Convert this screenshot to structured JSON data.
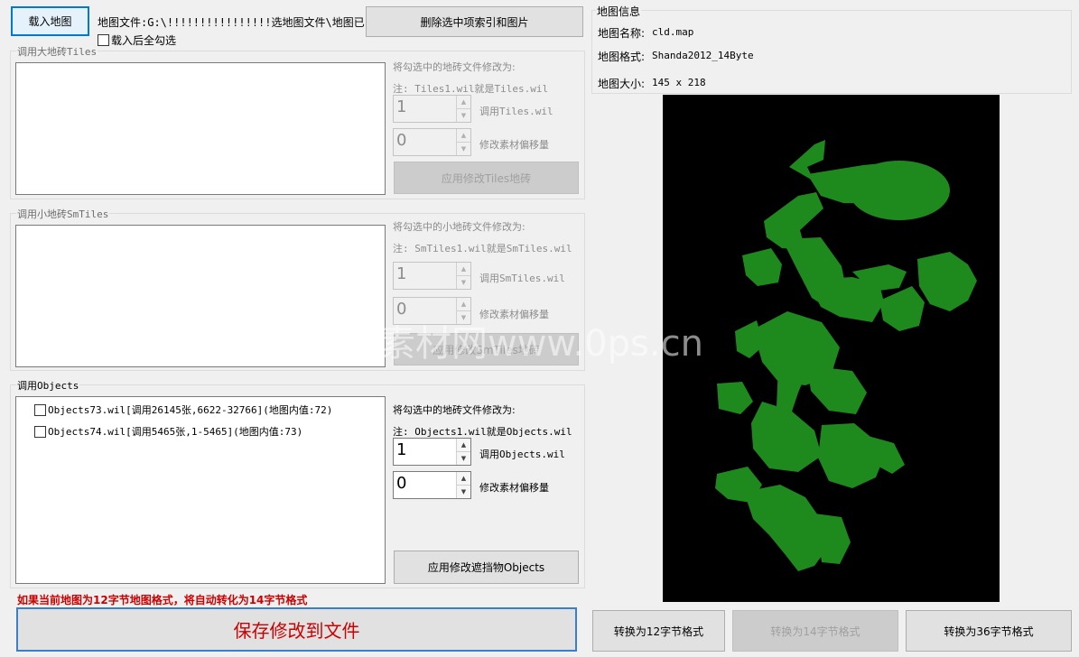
{
  "toolbar": {
    "load_map_label": "载入地图",
    "map_file_text": "地图文件:G:\\!!!!!!!!!!!!!!!!选地图文件\\地图已完成\\",
    "delete_selected_label": "删除选中项索引和图片",
    "select_all_after_load_label": "载入后全勾选",
    "select_all_after_load_checked": false
  },
  "tiles": {
    "legend": "调用大地砖Tiles",
    "change_to_label": "将勾选中的地砖文件修改为:",
    "note": "注: Tiles1.wil就是Tiles.wil",
    "index_value": "1",
    "index_suffix": "调用Tiles.wil",
    "offset_value": "0",
    "offset_label": "修改素材偏移量",
    "apply_label": "应用修改Tiles地砖"
  },
  "smtiles": {
    "legend": "调用小地砖SmTiles",
    "change_to_label": "将勾选中的小地砖文件修改为:",
    "note": "注: SmTiles1.wil就是SmTiles.wil",
    "index_value": "1",
    "index_suffix": "调用SmTiles.wil",
    "offset_value": "0",
    "offset_label": "修改素材偏移量",
    "apply_label": "应用修改SmTiles地砖"
  },
  "objects": {
    "legend": "调用Objects",
    "items": [
      {
        "label": "Objects73.wil[调用26145张,6622-32766](地图内值:72)",
        "checked": false
      },
      {
        "label": "Objects74.wil[调用5465张,1-5465](地图内值:73)",
        "checked": false
      }
    ],
    "change_to_label": "将勾选中的地砖文件修改为:",
    "note": "注: Objects1.wil就是Objects.wil",
    "index_value": "1",
    "index_suffix": "调用Objects.wil",
    "offset_value": "0",
    "offset_label": "修改素材偏移量",
    "apply_label": "应用修改遮挡物Objects"
  },
  "warning": "如果当前地图为12字节地图格式，将自动转化为14字节格式",
  "save_label": "保存修改到文件",
  "map_info": {
    "legend": "地图信息",
    "name_label": "地图名称:",
    "name_value": "cld.map",
    "format_label": "地图格式:",
    "format_value": "Shanda2012_14Byte",
    "size_label": "地图大小:",
    "size_value": "145 x 218"
  },
  "convert": {
    "to12_label": "转换为12字节格式",
    "to14_label": "转换为14字节格式",
    "to36_label": "转换为36字节格式"
  },
  "watermark": "素材网www.0ps.cn",
  "colors": {
    "map_bg": "#000000",
    "map_land": "#1e8a1e",
    "warning": "#cc0000"
  }
}
